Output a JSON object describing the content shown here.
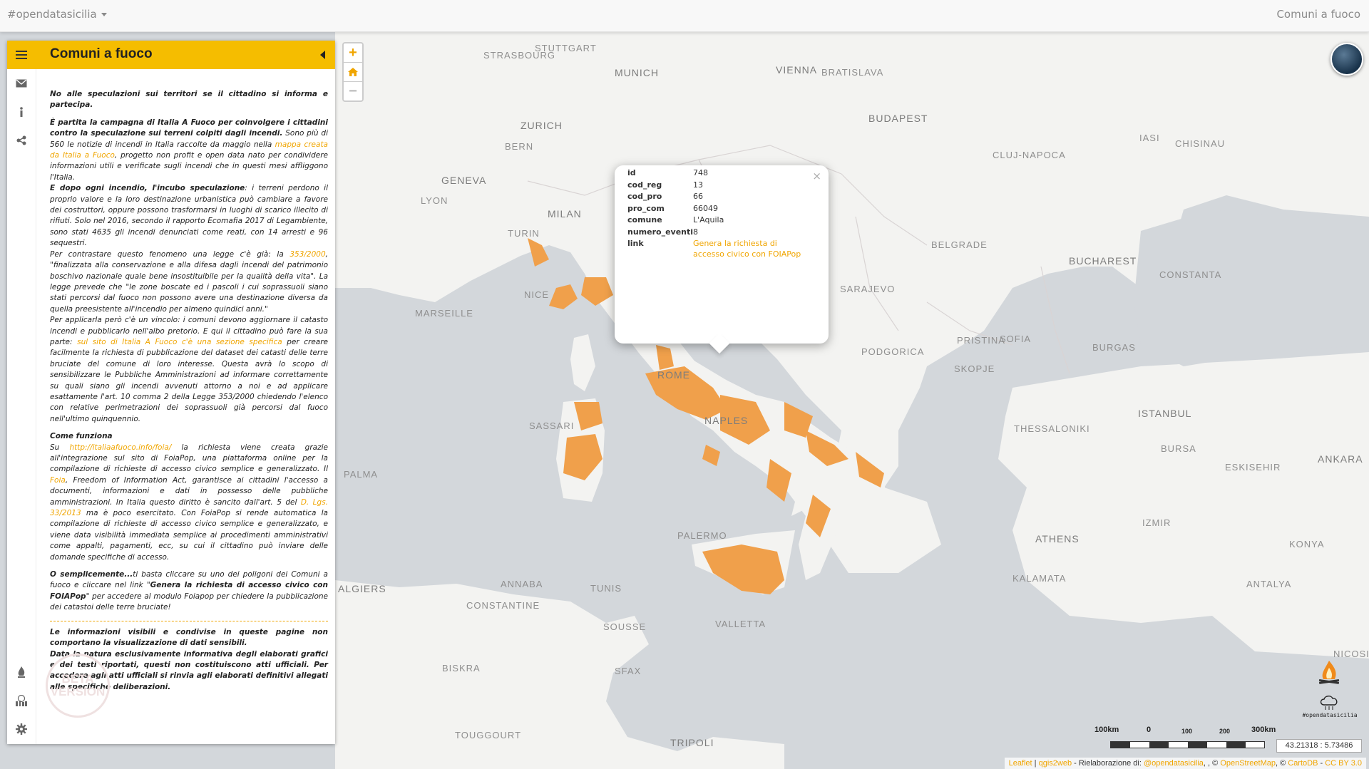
{
  "navbar": {
    "brand": "#opendatasicilia",
    "right_title": "Comuni a fuoco"
  },
  "colors": {
    "accent": "#f5bd00",
    "link": "#f0a500",
    "burned": "#f0a04b",
    "water": "#d3d7db",
    "land": "#f3f3f1"
  },
  "sidebar": {
    "title": "Comuni a fuoco",
    "tab_icons": [
      "menu-icon",
      "envelope-icon",
      "info-icon",
      "share-icon",
      "fire-icon",
      "city-icon",
      "gear-icon"
    ],
    "p1": "No alle speculazioni sui territori se il cittadino si informa e partecipa.",
    "p2_bold": "È partita la campagna di Italia A Fuoco per coinvolgere i cittadini contro la speculazione sui terreni colpiti dagli incendi.",
    "p2_a": " Sono più di 560 le notizie di incendi in Italia raccolte da maggio nella ",
    "p2_link": "mappa creata da Italia a Fuoco",
    "p2_b": ", progetto non profit e open data nato per condividere informazioni utili e verificate sugli incendi che in questi mesi affliggono l'Italia.",
    "p3_bold": "E dopo ogni incendio, l'incubo speculazione",
    "p3_a": ": i terreni perdono il proprio valore e la loro destinazione urbanistica può cambiare a favore dei costruttori, oppure possono trasformarsi in luoghi di scarico illecito di rifiuti. Solo nel 2016, secondo il rapporto Ecomafia 2017 di Legambiente, sono stati 4635 gli incendi denunciati come reati, con 14 arresti e 96 sequestri.",
    "p4_a": "Per contrastare questo fenomeno una legge c'è già: la ",
    "p4_link": "353/2000",
    "p4_b": ", \"finalizzata alla conservazione e alla difesa dagli incendi del patrimonio boschivo nazionale quale bene insostituibile per la qualità della vita\". La legge prevede che \"le zone boscate ed i pascoli i cui soprassuoli siano stati percorsi dal fuoco non possono avere una destinazione diversa da quella preesistente all'incendio per almeno quindici anni.\"",
    "p5_a": "Per applicarla però c'è un vincolo: i comuni devono aggiornare il catasto incendi e pubblicarlo nell'albo pretorio. E qui il cittadino può fare la sua parte: ",
    "p5_link": "sul sito di Italia A Fuoco c'è una sezione specifica",
    "p5_b": " per creare facilmente la richiesta di pubblicazione del dataset dei catasti delle terre bruciate del comune di loro interesse. Questa avrà lo scopo di sensibilizzare le Pubbliche Amministrazioni ad informare correttamente su quali siano gli incendi avvenuti attorno a noi e ad applicare esattamente l'art. 10 comma 2 della Legge 353/2000 chiedendo l'elenco con relative perimetrazioni dei soprassuoli già percorsi dal fuoco nell'ultimo quinquennio.",
    "how_title": "Come funziona",
    "how_a": "Su ",
    "how_link1": "http://italiaafuoco.info/foia/",
    "how_b": " la richiesta viene creata grazie all'integrazione sul sito di FoiaPop, una piattaforma online per la compilazione di richieste di accesso civico semplice e generalizzato. Il ",
    "how_link2": "Foia",
    "how_c": ", Freedom of Information Act, garantisce ai cittadini l'accesso a documenti, informazioni e dati in possesso delle pubbliche amministrazioni. In Italia questo diritto è sancito dall'art. 5 del ",
    "how_link3": "D. Lgs. 33/2013",
    "how_d": " ma è poco esercitato. Con FoiaPop si rende automatica la compilazione di richieste di accesso civico semplice e generalizzato, e viene data visibilità immediata semplice ai procedimenti amministrativi come appalti, pagamenti, ecc, su cui il cittadino può inviare delle domande specifiche di accesso.",
    "simple_bold": "O semplicemente...",
    "simple_a": "ti basta cliccare su uno dei poligoni dei Comuni a fuoco e cliccare nel link \"",
    "simple_bold2": "Genera la richiesta di accesso civico con FOIAPop",
    "simple_b": "\" per accedere al modulo Foiapop per chiedere la pubblicazione dei catastoi delle terre bruciate!",
    "disclaimer1": "Le informazioni visibili e condivise in queste pagine non comportano la visualizzazione di dati sensibili.",
    "disclaimer2": "Data la natura esclusivamente informativa degli elaborati grafici e dei testi riportati, questi non costituiscono atti ufficiali. Per accedere agli atti ufficiali si rinvia agli elaborati definitivi allegati alle specifiche deliberazioni.",
    "beta_text": "BETA VERSION"
  },
  "zoom": {
    "in": "+",
    "out": "−",
    "home_icon": "home-icon"
  },
  "popup": {
    "close": "×",
    "rows": [
      {
        "key": "id",
        "value": "748"
      },
      {
        "key": "cod_reg",
        "value": "13"
      },
      {
        "key": "cod_pro",
        "value": "66"
      },
      {
        "key": "pro_com",
        "value": "66049"
      },
      {
        "key": "comune",
        "value": "L'Aquila"
      },
      {
        "key": "numero_eventi",
        "value": "8"
      }
    ],
    "link_key": "link",
    "link_text": "Genera la richiesta di accesso civico con FOIAPop"
  },
  "map_labels": [
    "STRASBOURG",
    "STUTTGART",
    "MUNICH",
    "VIENNA",
    "BRATISLAVA",
    "BUDAPEST",
    "ZURICH",
    "BERN",
    "GENEVA",
    "LYON",
    "MILAN",
    "TURIN",
    "NICE",
    "MARSEILLE",
    "ROME",
    "NAPLES",
    "SASSARI",
    "PALMA",
    "ALGIERS",
    "ANNABA",
    "CONSTANTINE",
    "TUNIS",
    "SOUSSE",
    "SFAX",
    "PALERMO",
    "VALLETTA",
    "BISKRA",
    "TOUGGOURT",
    "TRIPOLI",
    "SARAJEVO",
    "BELGRADE",
    "PRISTINA",
    "PODGORICA",
    "SKOPJE",
    "SOFIA",
    "BURGAS",
    "BUCHAREST",
    "CONSTANTA",
    "CHISINAU",
    "IASI",
    "CLUJ-NAPOCA",
    "ISTANBUL",
    "BURSA",
    "ESKISEHIR",
    "ANKARA",
    "IZMIR",
    "KONYA",
    "ANTALYA",
    "KALAMATA",
    "ATHENS",
    "THESSALONIKI",
    "NICOSIA"
  ],
  "scale": {
    "l1": "100km",
    "l2": "0",
    "l3": "100",
    "l4": "200",
    "l5": "300km"
  },
  "coordinates": "43.21318 : 5.73486",
  "logo_fire_caption": "#opendatasicilia",
  "attribution": {
    "leaflet": "Leaflet",
    "sep1": " | ",
    "qgis": "qgis2web",
    "rel": " - Rielaborazione di: ",
    "ods": "@opendatasicilia",
    "mid": ", , © ",
    "osm": "OpenStreetMap",
    "mid2": ", © ",
    "carto": "CartoDB",
    "mid3": " - ",
    "cc": "CC BY 3.0"
  }
}
